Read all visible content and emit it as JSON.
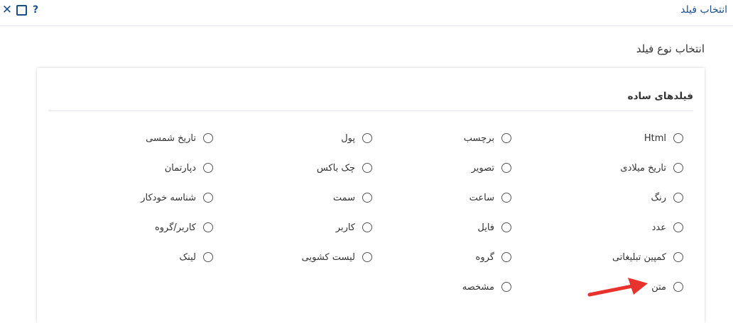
{
  "window": {
    "title": "انتخاب فیلد",
    "close_symbol": "✕",
    "help_symbol": "?"
  },
  "section_title": "انتخاب نوع فیلد",
  "group": {
    "title": "فیلدهای ساده",
    "columns": [
      [
        "Html",
        "تاریخ میلادی",
        "رنگ",
        "عدد",
        "کمپین تبلیغاتی",
        "متن"
      ],
      [
        "برچسب",
        "تصویر",
        "ساعت",
        "فایل",
        "گروه",
        "مشخصه"
      ],
      [
        "پول",
        "چک باکس",
        "سمت",
        "کاربر",
        "لیست کشویی"
      ],
      [
        "تاریخ شمسی",
        "دپارتمان",
        "شناسه خودکار",
        "کاربر/گروه",
        "لینک"
      ]
    ]
  },
  "colors": {
    "accent": "#1b4f8a",
    "arrow": "#e8322e"
  }
}
